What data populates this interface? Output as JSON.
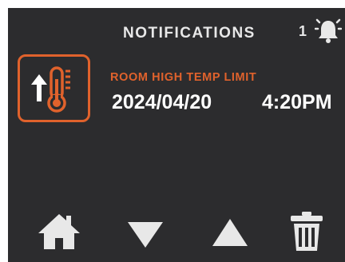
{
  "header": {
    "title": "NOTIFICATIONS",
    "count": "1",
    "bell_icon": "bell-ringing-icon"
  },
  "notification": {
    "icon": "thermometer-high-temp-icon",
    "type_label": "ROOM HIGH TEMP LIMIT",
    "date": "2024/04/20",
    "time": "4:20PM"
  },
  "nav": {
    "home_icon": "home-icon",
    "down_icon": "arrow-down-icon",
    "up_icon": "arrow-up-icon",
    "delete_icon": "trash-icon"
  },
  "colors": {
    "background": "#2c2c2e",
    "accent": "#e0622c",
    "text": "#ffffff",
    "icon": "#e8e8e8"
  }
}
